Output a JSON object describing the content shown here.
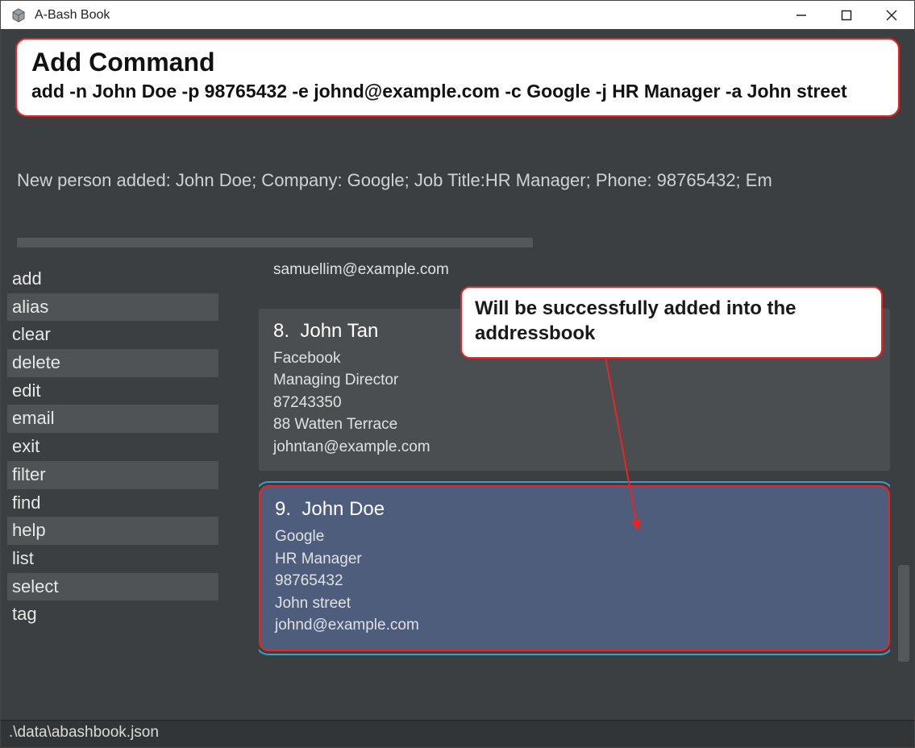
{
  "window": {
    "title": "A-Bash Book"
  },
  "callout": {
    "heading": "Add Command",
    "command": "add -n John Doe -p 98765432 -e johnd@example.com -c Google -j HR Manager -a John street"
  },
  "result_message": "New person added: John Doe; Company: Google; Job Title:HR Manager; Phone: 98765432; Em",
  "sidebar": {
    "commands": [
      "add",
      "alias",
      "clear",
      "delete",
      "edit",
      "email",
      "exit",
      "filter",
      "find",
      "help",
      "list",
      "select",
      "tag"
    ]
  },
  "cards": {
    "partial": {
      "email": "samuellim@example.com"
    },
    "card8": {
      "index": "8.",
      "name": "John Tan",
      "company": "Facebook",
      "job": "Managing Director",
      "phone": "87243350",
      "address": "88 Watten Terrace",
      "email": "johntan@example.com"
    },
    "card9": {
      "index": "9.",
      "name": "John Doe",
      "company": "Google",
      "job": "HR Manager",
      "phone": "98765432",
      "address": "John street",
      "email": "johnd@example.com"
    }
  },
  "note": "Will be successfully added into the addressbook",
  "statusbar": {
    "path": ".\\data\\abashbook.json"
  }
}
